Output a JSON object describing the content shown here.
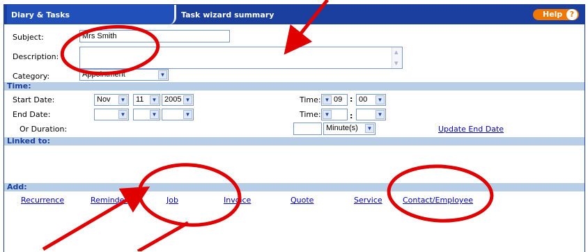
{
  "tabs": {
    "active": "Diary & Tasks",
    "second": "Task wizard summary"
  },
  "help": {
    "label": "Help",
    "icon": "?"
  },
  "form": {
    "subject_label": "Subject:",
    "subject_value": "Mrs Smith",
    "description_label": "Description:",
    "description_value": "",
    "category_label": "Category:",
    "category_value": "Appointment"
  },
  "sections": {
    "time": "Time:",
    "linked": "Linked to:",
    "add": "Add:"
  },
  "time": {
    "start_label": "Start Date:",
    "end_label": "End Date:",
    "duration_label": "Or Duration:",
    "time_label": "Time:",
    "start_month": "Nov",
    "start_day": "11",
    "start_year": "2005",
    "start_hour": "09",
    "start_minute": "00",
    "end_month": "",
    "end_day": "",
    "end_year": "",
    "end_hour": "",
    "end_minute": "",
    "duration_value": "",
    "duration_unit": "Minute(s)",
    "time_colon": ":",
    "update_link": "Update End Date"
  },
  "add_links": [
    "Recurrence",
    "Reminder",
    "Job",
    "Invoice",
    "Quote",
    "Service",
    "Contact/Employee"
  ],
  "annotation_color": "#e00000"
}
